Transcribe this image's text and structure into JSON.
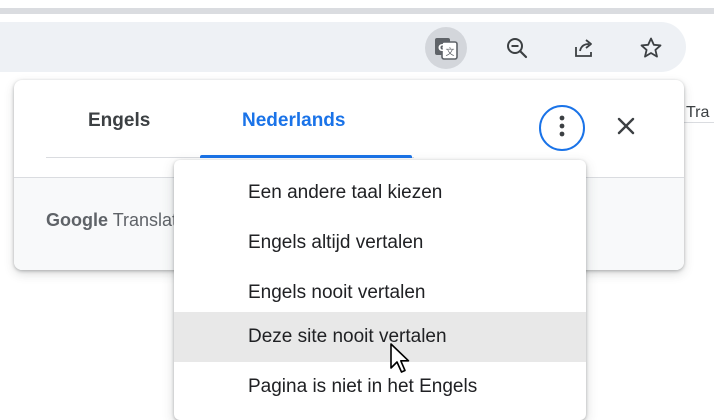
{
  "toolbar": {
    "translate_icon": "google-translate-icon",
    "zoom_icon": "zoom-out-icon",
    "share_icon": "share-icon",
    "bookmark_icon": "star-icon"
  },
  "page": {
    "partial_text": "Tra"
  },
  "bubble": {
    "source_tab": "Engels",
    "target_tab": "Nederlands",
    "more_icon": "more-vert-icon",
    "close_icon": "close-icon",
    "logo_google": "Google",
    "logo_product": "Translate",
    "accent_color": "#1a73e8"
  },
  "menu": {
    "items": [
      {
        "label": "Een andere taal kiezen"
      },
      {
        "label": "Engels altijd vertalen"
      },
      {
        "label": "Engels nooit vertalen"
      },
      {
        "label": "Deze site nooit vertalen",
        "hovered": true
      },
      {
        "label": "Pagina is niet in het Engels"
      }
    ]
  }
}
